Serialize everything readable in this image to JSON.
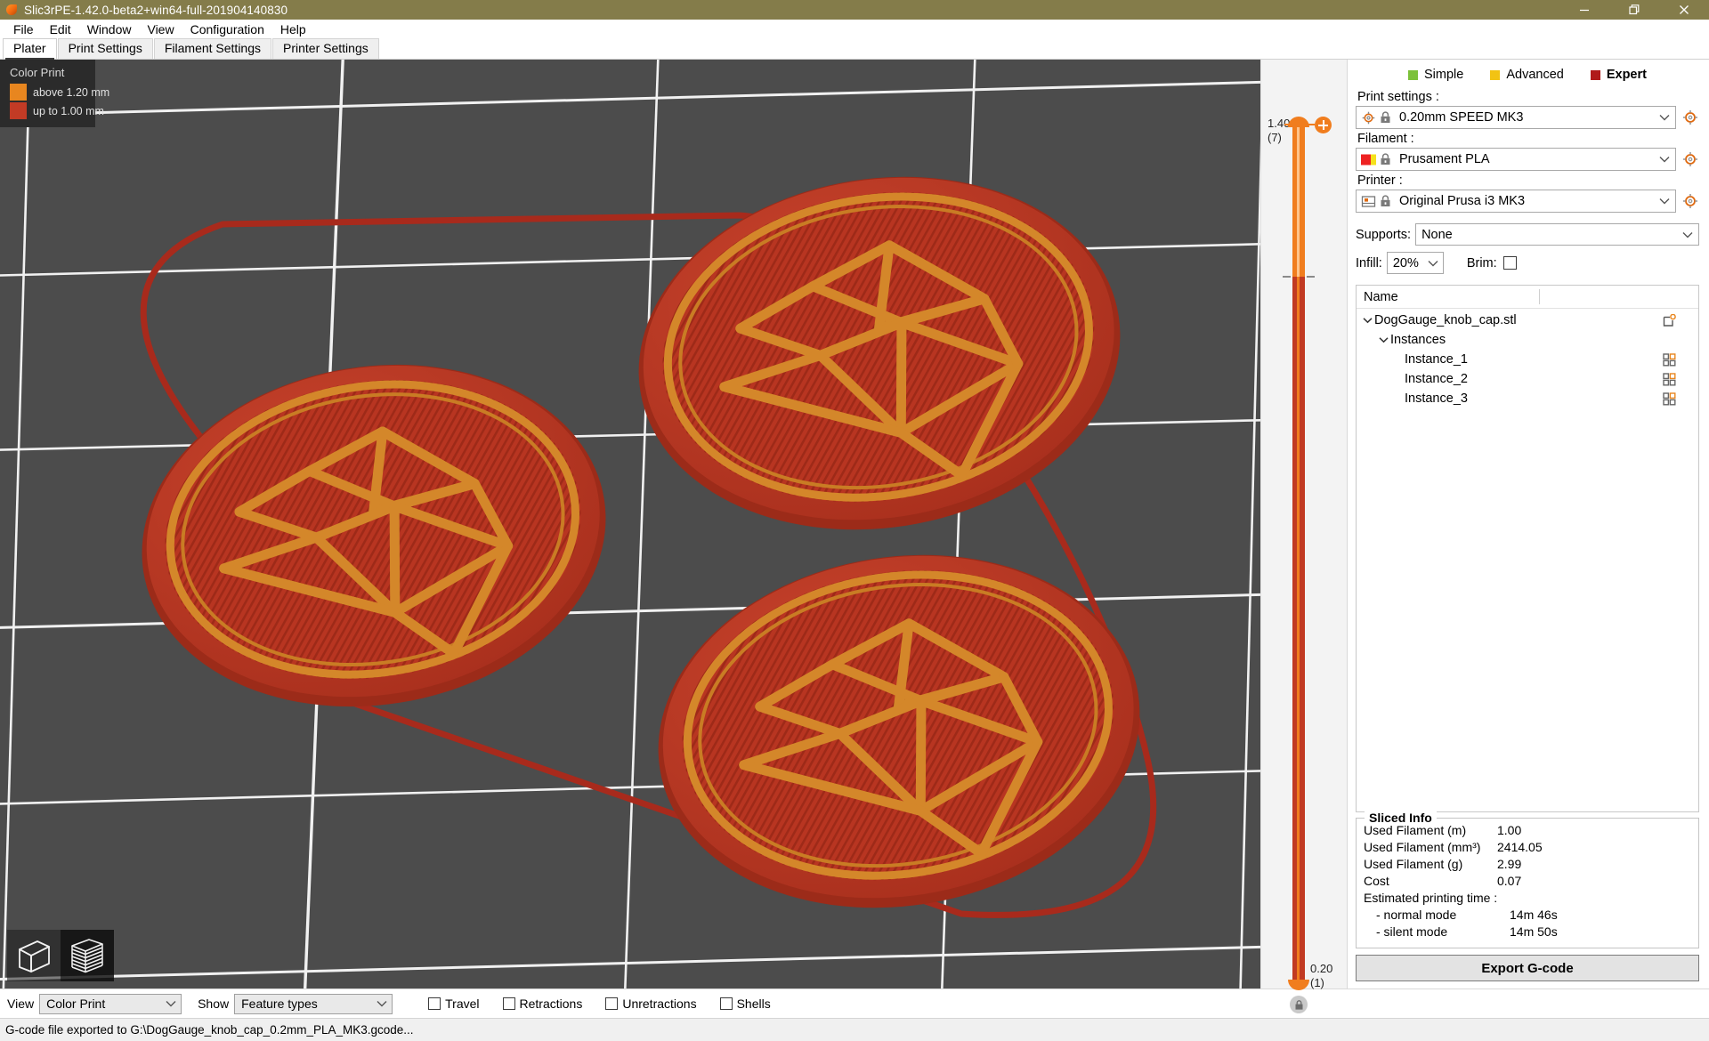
{
  "window": {
    "title": "Slic3rPE-1.42.0-beta2+win64-full-201904140830",
    "icon": "slic3r-logo-icon",
    "minimize": "minimize-icon",
    "maximize": "restore-icon",
    "close": "close-icon",
    "titlebar_color": "#847c4a"
  },
  "menu": {
    "items": [
      "File",
      "Edit",
      "Window",
      "View",
      "Configuration",
      "Help"
    ]
  },
  "tabs": [
    {
      "label": "Plater",
      "active": true
    },
    {
      "label": "Print Settings",
      "active": false
    },
    {
      "label": "Filament Settings",
      "active": false
    },
    {
      "label": "Printer Settings",
      "active": false
    }
  ],
  "viewport": {
    "legend": {
      "title": "Color Print",
      "entries": [
        {
          "color": "#e8861f",
          "label": "above 1.20 mm"
        },
        {
          "color": "#c23b25",
          "label": "up to 1.00 mm"
        }
      ]
    },
    "view_modes": [
      {
        "name": "3d-editor-view-icon",
        "selected": false
      },
      {
        "name": "preview-layers-view-icon",
        "selected": true
      }
    ],
    "bed_color": "#4c4c4c",
    "grid_color": "#ffffff",
    "model_perimeter_color": "#c13a22",
    "model_line_color": "#d4872a",
    "travel_color": "#a82a1c"
  },
  "layer_slider": {
    "top_value": "1.40",
    "top_layer": "(7)",
    "bottom_value": "0.20",
    "bottom_layer": "(1)",
    "add_color_change_icon": "plus-circle-icon",
    "lock_icon": "lock-icon",
    "upper_track_color": "#f07d1e",
    "lower_track_color": "#c13a22"
  },
  "panel": {
    "modes": [
      {
        "label": "Simple",
        "color": "#7cc13a",
        "active": false
      },
      {
        "label": "Advanced",
        "color": "#f2c313",
        "active": false
      },
      {
        "label": "Expert",
        "color": "#b01a1a",
        "active": true
      }
    ],
    "print_settings": {
      "label": "Print settings :",
      "value": "0.20mm SPEED MK3",
      "icon": "print-settings-cog-icon",
      "lock_icon": "lock-closed-icon",
      "caret": "chevron-down-icon",
      "edit_icon": "cog-icon"
    },
    "filament": {
      "label": "Filament :",
      "value": "Prusament PLA",
      "icon": "filament-spool-icon",
      "swatch_left": "#ee2222",
      "swatch_right": "#f5e11c",
      "lock_icon": "lock-closed-icon",
      "caret": "chevron-down-icon",
      "edit_icon": "cog-icon"
    },
    "printer": {
      "label": "Printer :",
      "value": "Original Prusa i3 MK3",
      "icon": "printer-bed-icon",
      "lock_icon": "lock-closed-icon",
      "caret": "chevron-down-icon",
      "edit_icon": "cog-icon"
    },
    "supports": {
      "label": "Supports:",
      "value": "None",
      "caret": "chevron-down-icon"
    },
    "infill": {
      "label": "Infill:",
      "value": "20%",
      "caret": "chevron-down-icon"
    },
    "brim": {
      "label": "Brim:",
      "checked": false
    },
    "tree": {
      "columns": [
        "Name",
        ""
      ],
      "rows": [
        {
          "label": "DogGauge_knob_cap.stl",
          "indent": 0,
          "chevron": "chevron-down-icon",
          "action_icon": "add-part-icon"
        },
        {
          "label": "Instances",
          "indent": 1,
          "chevron": "chevron-down-icon",
          "action_icon": ""
        },
        {
          "label": "Instance_1",
          "indent": 2,
          "chevron": "",
          "action_icon": "instances-grid-icon"
        },
        {
          "label": "Instance_2",
          "indent": 2,
          "chevron": "",
          "action_icon": "instances-grid-icon"
        },
        {
          "label": "Instance_3",
          "indent": 2,
          "chevron": "",
          "action_icon": "instances-grid-icon"
        }
      ]
    },
    "sliced_info": {
      "title": "Sliced Info",
      "rows": [
        {
          "key": "Used Filament (m)",
          "value": "1.00"
        },
        {
          "key": "Used Filament (mm³)",
          "value": "2414.05"
        },
        {
          "key": "Used Filament (g)",
          "value": "2.99"
        },
        {
          "key": "Cost",
          "value": "0.07"
        }
      ],
      "time_label": "Estimated printing time :",
      "times": [
        {
          "key": "- normal mode",
          "value": "14m 46s"
        },
        {
          "key": "- silent mode",
          "value": "14m 50s"
        }
      ]
    },
    "export_button": "Export G-code"
  },
  "bottom_bar": {
    "view_label": "View",
    "view_value": "Color Print",
    "show_label": "Show",
    "show_value": "Feature types",
    "checkboxes": [
      {
        "label": "Travel",
        "checked": false
      },
      {
        "label": "Retractions",
        "checked": false
      },
      {
        "label": "Unretractions",
        "checked": false
      },
      {
        "label": "Shells",
        "checked": false
      }
    ]
  },
  "status_bar": {
    "text": "G-code file exported to G:\\DogGauge_knob_cap_0.2mm_PLA_MK3.gcode..."
  }
}
